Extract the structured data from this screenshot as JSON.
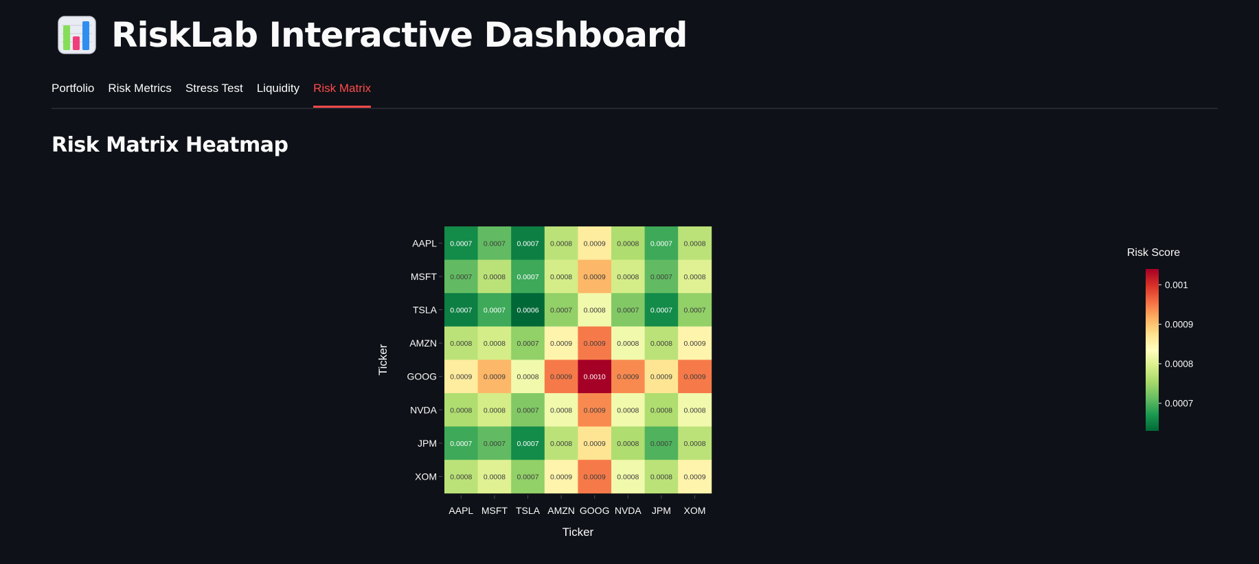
{
  "app": {
    "icon": "bar-chart-icon",
    "title": "RiskLab Interactive Dashboard"
  },
  "tabs": [
    {
      "label": "Portfolio",
      "active": false
    },
    {
      "label": "Risk Metrics",
      "active": false
    },
    {
      "label": "Stress Test",
      "active": false
    },
    {
      "label": "Liquidity",
      "active": false
    },
    {
      "label": "Risk Matrix",
      "active": true
    }
  ],
  "section": {
    "title": "Risk Matrix Heatmap"
  },
  "colors": {
    "background": "#0e1117",
    "accent": "#ff4b4b",
    "text": "#fafafa"
  },
  "chart_data": {
    "type": "heatmap",
    "title": "",
    "xlabel": "Ticker",
    "ylabel": "Ticker",
    "categories_x": [
      "AAPL",
      "MSFT",
      "TSLA",
      "AMZN",
      "GOOG",
      "NVDA",
      "JPM",
      "XOM"
    ],
    "categories_y": [
      "AAPL",
      "MSFT",
      "TSLA",
      "AMZN",
      "GOOG",
      "NVDA",
      "JPM",
      "XOM"
    ],
    "values": [
      [
        0.00066,
        0.00071,
        0.00065,
        0.00077,
        0.00086,
        0.00076,
        0.00069,
        0.00077
      ],
      [
        0.00071,
        0.00077,
        0.00069,
        0.00079,
        0.00091,
        0.00079,
        0.00071,
        0.0008
      ],
      [
        0.00065,
        0.00069,
        0.00063,
        0.00074,
        0.00082,
        0.00073,
        0.00066,
        0.00074
      ],
      [
        0.00077,
        0.00079,
        0.00074,
        0.00085,
        0.00095,
        0.00082,
        0.00077,
        0.00085
      ],
      [
        0.00086,
        0.00091,
        0.00082,
        0.00095,
        0.00104,
        0.00094,
        0.00087,
        0.00095
      ],
      [
        0.00076,
        0.00079,
        0.00073,
        0.00082,
        0.00094,
        0.00082,
        0.00076,
        0.00082
      ],
      [
        0.00069,
        0.00071,
        0.00066,
        0.00077,
        0.00087,
        0.00076,
        0.0007,
        0.00077
      ],
      [
        0.00077,
        0.0008,
        0.00074,
        0.00085,
        0.00095,
        0.00082,
        0.00077,
        0.00085
      ]
    ],
    "cell_labels": [
      [
        "0.0007",
        "0.0007",
        "0.0007",
        "0.0008",
        "0.0009",
        "0.0008",
        "0.0007",
        "0.0008"
      ],
      [
        "0.0007",
        "0.0008",
        "0.0007",
        "0.0008",
        "0.0009",
        "0.0008",
        "0.0007",
        "0.0008"
      ],
      [
        "0.0007",
        "0.0007",
        "0.0006",
        "0.0007",
        "0.0008",
        "0.0007",
        "0.0007",
        "0.0007"
      ],
      [
        "0.0008",
        "0.0008",
        "0.0007",
        "0.0009",
        "0.0009",
        "0.0008",
        "0.0008",
        "0.0009"
      ],
      [
        "0.0009",
        "0.0009",
        "0.0008",
        "0.0009",
        "0.0010",
        "0.0009",
        "0.0009",
        "0.0009"
      ],
      [
        "0.0008",
        "0.0008",
        "0.0007",
        "0.0008",
        "0.0009",
        "0.0008",
        "0.0008",
        "0.0008"
      ],
      [
        "0.0007",
        "0.0007",
        "0.0007",
        "0.0008",
        "0.0009",
        "0.0008",
        "0.0007",
        "0.0008"
      ],
      [
        "0.0008",
        "0.0008",
        "0.0007",
        "0.0009",
        "0.0009",
        "0.0008",
        "0.0008",
        "0.0009"
      ]
    ],
    "colorscale": "RdYlGn_r",
    "colorbar": {
      "title": "Risk Score",
      "range": [
        0.00063,
        0.00104
      ],
      "tick_values": [
        0.001,
        0.0009,
        0.0008,
        0.0007
      ],
      "tick_labels": [
        "0.001",
        "0.0009",
        "0.0008",
        "0.0007"
      ]
    }
  }
}
